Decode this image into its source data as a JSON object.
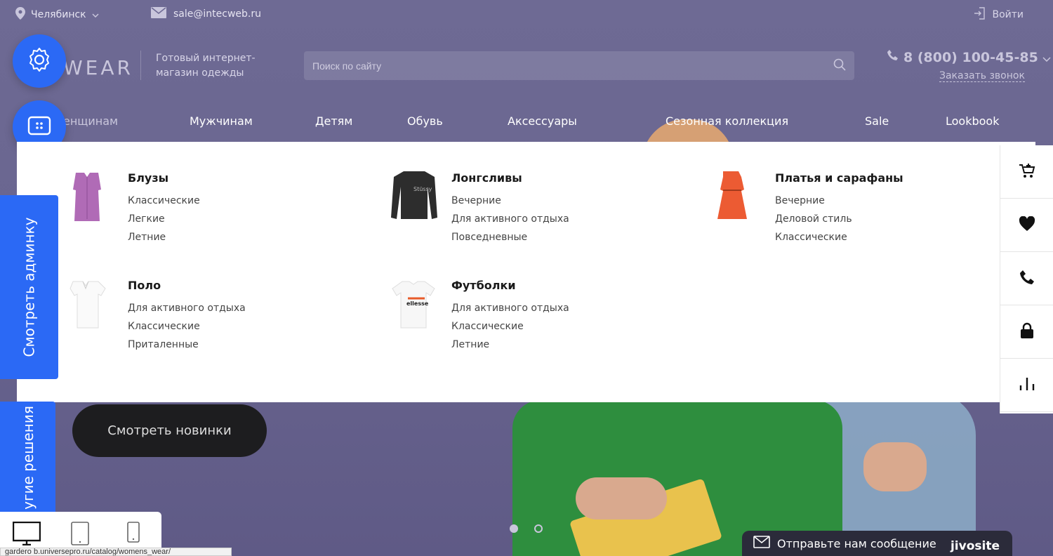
{
  "topbar": {
    "city": "Челябинск",
    "email": "sale@intecweb.ru",
    "login": "Войти"
  },
  "header": {
    "logo": "WEAR",
    "tagline": "Готовый интернет-магазин одежды",
    "search_placeholder": "Поиск по сайту",
    "phone": "8 (800) 100-45-85",
    "callback": "Заказать звонок"
  },
  "nav": {
    "items": [
      {
        "label": "енщинам"
      },
      {
        "label": "Мужчинам"
      },
      {
        "label": "Детям"
      },
      {
        "label": "Обувь"
      },
      {
        "label": "Аксессуары"
      },
      {
        "label": "Сезонная коллекция"
      },
      {
        "label": "Sale"
      },
      {
        "label": "Lookbook"
      }
    ]
  },
  "side": {
    "admin": "Смотреть админку",
    "other": "угие решения"
  },
  "mega": {
    "categories": [
      {
        "title": "Блузы",
        "subs": [
          "Классические",
          "Легкие",
          "Летние"
        ]
      },
      {
        "title": "Лонгсливы",
        "subs": [
          "Вечерние",
          "Для активного отдыха",
          "Повседневные"
        ]
      },
      {
        "title": "Платья и сарафаны",
        "subs": [
          "Вечерние",
          "Деловой стиль",
          "Классические"
        ]
      },
      {
        "title": "Поло",
        "subs": [
          "Для активного отдыха",
          "Классические",
          "Приталенные"
        ]
      },
      {
        "title": "Футболки",
        "subs": [
          "Для активного отдыха",
          "Классические",
          "Летние"
        ]
      }
    ]
  },
  "hero": {
    "cta": "Смотреть новинки"
  },
  "status_url": "gardero b.universepro.ru/catalog/womens_wear/",
  "jivo": {
    "message": "Отправьте нам сообщение",
    "brand": "jivosite"
  },
  "colors": {
    "accent": "#2b69f5",
    "hero": "#6e6a94"
  }
}
